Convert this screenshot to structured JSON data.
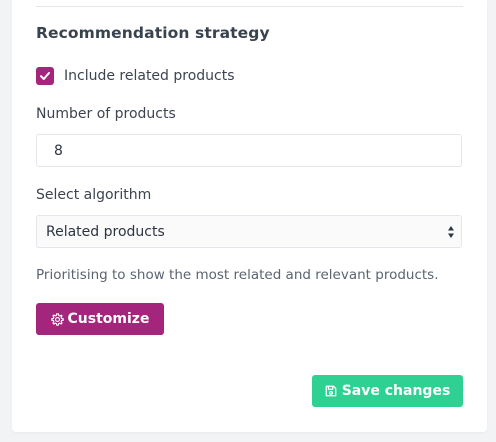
{
  "section": {
    "title": "Recommendation strategy"
  },
  "include_related": {
    "label": "Include related products",
    "checked": true
  },
  "product_count": {
    "label": "Number of products",
    "value": "8"
  },
  "algorithm": {
    "label": "Select algorithm",
    "selected": "Related products"
  },
  "help_text": "Prioritising to show the most related and relevant products.",
  "buttons": {
    "customize_label": "Customize",
    "save_label": "Save changes"
  },
  "icons": {
    "customize": "gear-icon",
    "save": "floppy-disk-icon",
    "checkbox": "checkmark-icon",
    "select": "select-arrows-icon"
  },
  "colors": {
    "accent": "#a3257c",
    "save": "#2ed191"
  }
}
